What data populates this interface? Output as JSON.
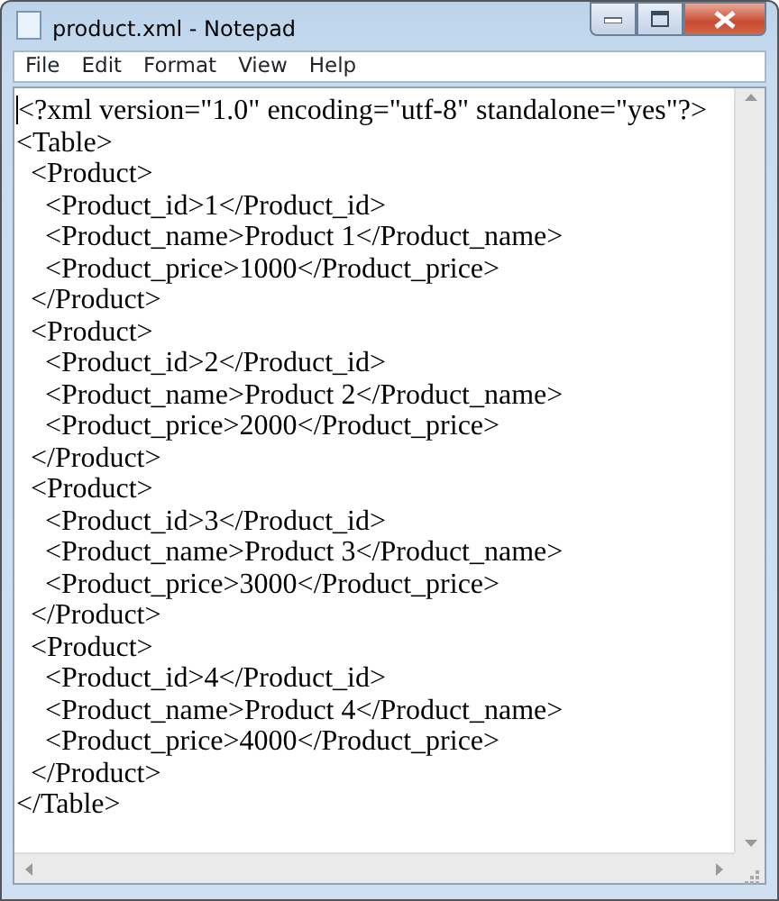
{
  "window": {
    "title": "product.xml - Notepad"
  },
  "menu": [
    "File",
    "Edit",
    "Format",
    "View",
    "Help"
  ],
  "editor": {
    "lines": [
      "<?xml version=\"1.0\" encoding=\"utf-8\" standalone=\"yes\"?>",
      "<Table>",
      "  <Product>",
      "    <Product_id>1</Product_id>",
      "    <Product_name>Product 1</Product_name>",
      "    <Product_price>1000</Product_price>",
      "  </Product>",
      "  <Product>",
      "    <Product_id>2</Product_id>",
      "    <Product_name>Product 2</Product_name>",
      "    <Product_price>2000</Product_price>",
      "  </Product>",
      "  <Product>",
      "    <Product_id>3</Product_id>",
      "    <Product_name>Product 3</Product_name>",
      "    <Product_price>3000</Product_price>",
      "  </Product>",
      "  <Product>",
      "    <Product_id>4</Product_id>",
      "    <Product_name>Product 4</Product_name>",
      "    <Product_price>4000</Product_price>",
      "  </Product>",
      "</Table>"
    ]
  }
}
